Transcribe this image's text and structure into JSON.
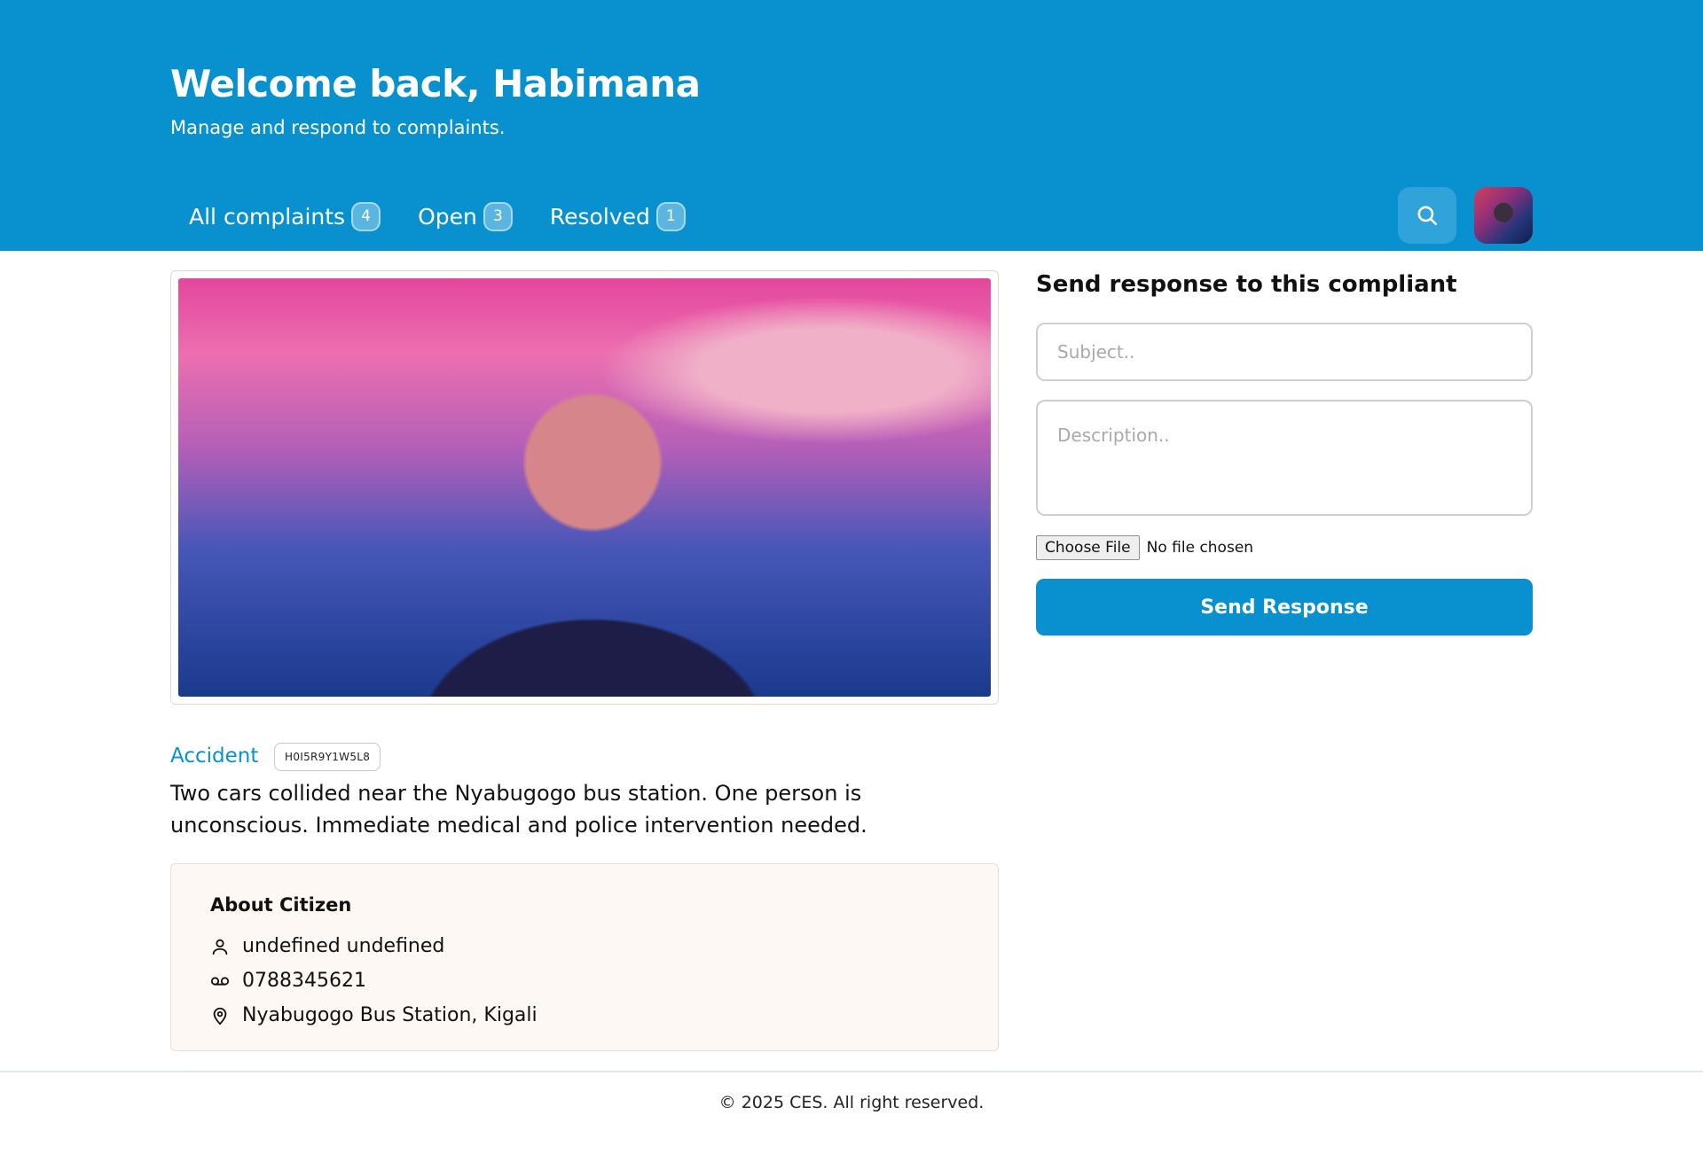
{
  "header": {
    "title": "Welcome back, Habimana",
    "subtitle": "Manage and respond to complaints."
  },
  "tabs": [
    {
      "label": "All complaints",
      "count": "4"
    },
    {
      "label": "Open",
      "count": "3"
    },
    {
      "label": "Resolved",
      "count": "1"
    }
  ],
  "icons": {
    "search": "search-icon",
    "person": "user-icon",
    "phone": "voicemail-icon",
    "location": "map-pin-icon"
  },
  "complaint": {
    "category": "Accident",
    "code": "H0I5R9Y1W5L8",
    "description": "Two cars collided near the Nyabugogo bus station. One person is unconscious. Immediate medical and police intervention needed."
  },
  "citizen": {
    "heading": "About Citizen",
    "name": "undefined undefined",
    "phone": "0788345621",
    "location": "Nyabugogo Bus Station, Kigali"
  },
  "response_form": {
    "title": "Send response to this compliant",
    "subject_placeholder": "Subject..",
    "description_placeholder": "Description..",
    "file_button": "Choose File",
    "file_status": "No file chosen",
    "submit_label": "Send Response"
  },
  "footer": {
    "text": "© 2025 CES. All right reserved."
  },
  "colors": {
    "primary": "#0891ce",
    "citizen_bg": "#fdf8f3"
  }
}
